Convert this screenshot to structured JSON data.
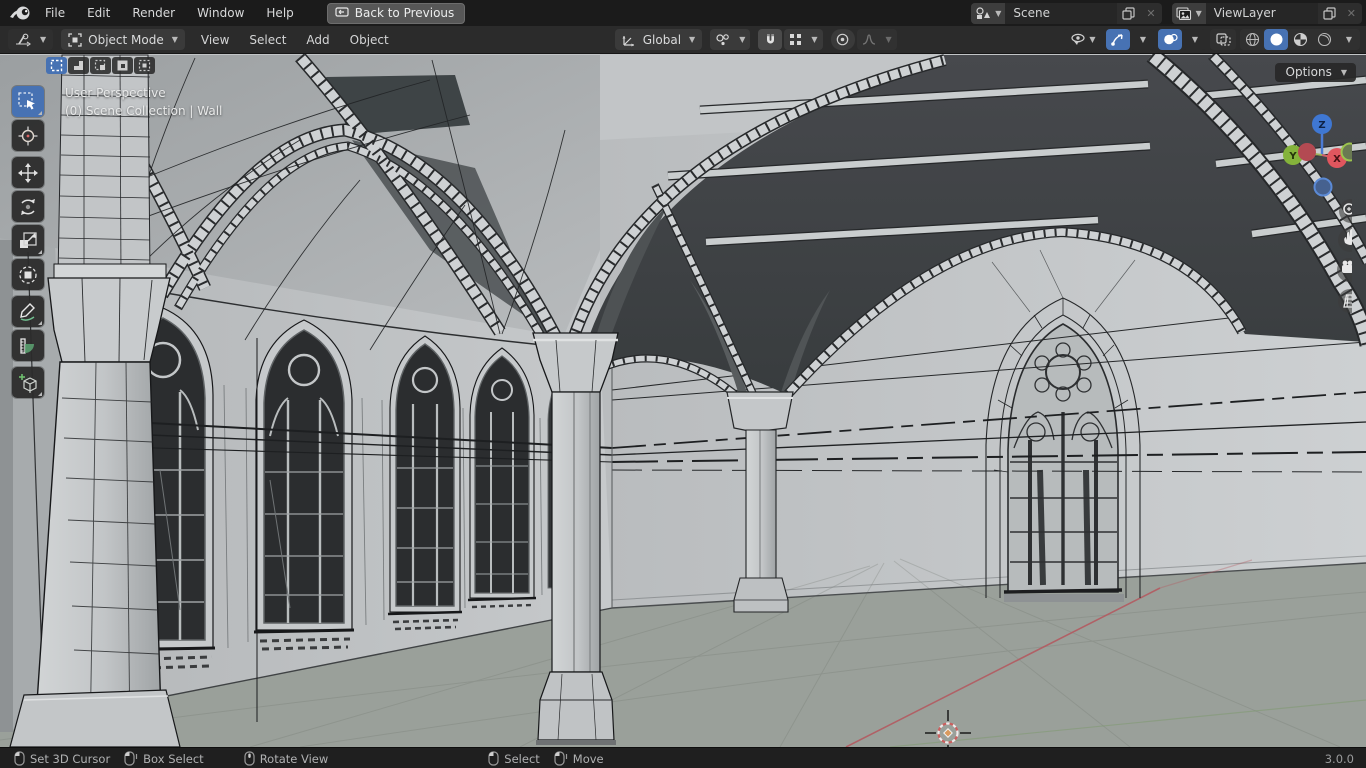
{
  "topbar": {
    "menus": [
      "File",
      "Edit",
      "Render",
      "Window",
      "Help"
    ],
    "back_label": "Back to Previous",
    "scene": {
      "label": "Scene"
    },
    "viewlayer": {
      "label": "ViewLayer"
    }
  },
  "header": {
    "mode_label": "Object Mode",
    "menus": [
      "View",
      "Select",
      "Add",
      "Object"
    ],
    "orientation_label": "Global"
  },
  "viewport": {
    "options_label": "Options",
    "view_label": "User Perspective",
    "collection_label": "(0) Scene Collection | Wall",
    "gizmo": {
      "x": "X",
      "y": "Y",
      "z": "Z"
    }
  },
  "toolbar": {
    "tools": [
      "box-select",
      "cursor",
      "move",
      "rotate",
      "scale",
      "transform",
      "annotate",
      "measure",
      "add-cube"
    ]
  },
  "statusbar": {
    "hints": [
      "Set 3D Cursor",
      "Box Select",
      "Rotate View",
      "Select",
      "Move"
    ],
    "version": "3.0.0"
  },
  "colors": {
    "accent_blue": "#4772b3",
    "axis_x_red": "#e0565e",
    "axis_y_green": "#84b33b",
    "axis_z_blue": "#3f77d2",
    "wall_gray": "#c3c6c8",
    "vault_dark": "#43464a",
    "floor_green_gray": "#9aa09a",
    "glass_dark": "#2b2d2f"
  }
}
